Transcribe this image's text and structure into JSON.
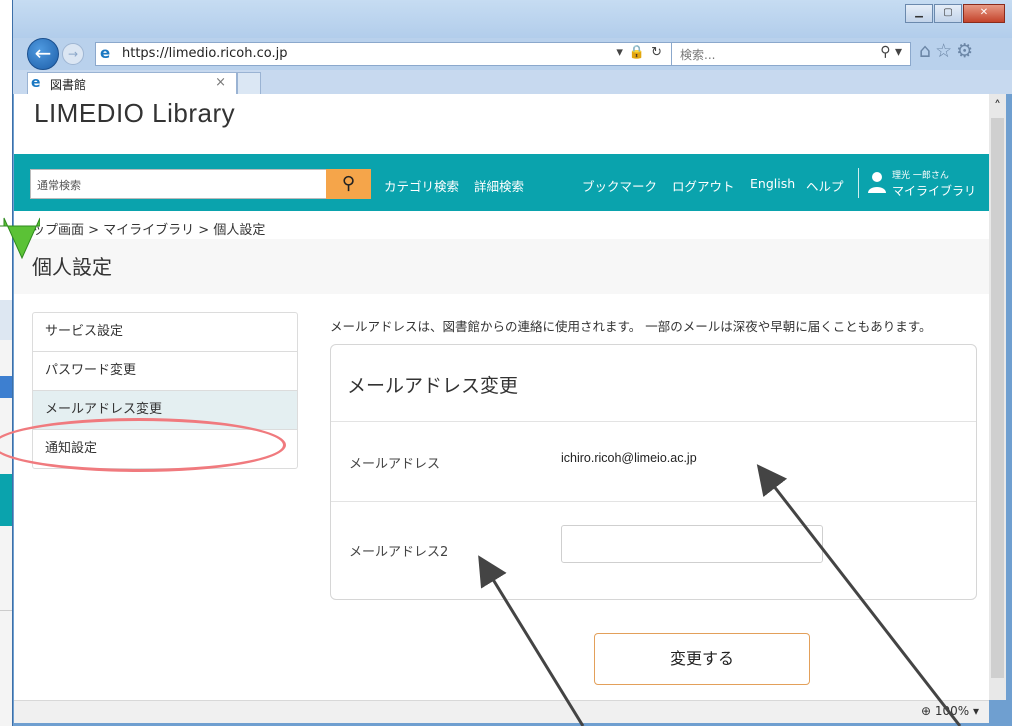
{
  "browser": {
    "url": "https://limedio.ricoh.co.jp",
    "search_placeholder": "検索...",
    "tab_title": "図書館",
    "tab_close": "×",
    "zoom": "100%",
    "window_controls": [
      "minimize-icon",
      "maximize-icon",
      "close-icon"
    ]
  },
  "site": {
    "brand": "LIMEDIO Library",
    "search_placeholder": "通常検索",
    "nav": {
      "category_search": "カテゴリ検索",
      "advanced_search": "詳細検索",
      "bookmark": "ブックマーク",
      "logout": "ログアウト",
      "english": "English",
      "help": "ヘルプ"
    },
    "user": {
      "name": "理光 一郎さん",
      "mylibrary": "マイライブラリ"
    },
    "colors": {
      "navbar": "#0aa3ad",
      "search_button": "#f5a54a",
      "button_border": "#e3a05a"
    }
  },
  "breadcrumb": "ップ画面 > マイライブラリ > 個人設定",
  "page_title": "個人設定",
  "sidebar": {
    "items": [
      {
        "label": "サービス設定"
      },
      {
        "label": "パスワード変更"
      },
      {
        "label": "メールアドレス変更",
        "active": true
      },
      {
        "label": "通知設定"
      }
    ]
  },
  "main": {
    "notice": "メールアドレスは、図書館からの連絡に使用されます。 一部のメールは深夜や早朝に届くこともあります。",
    "card_title": "メールアドレス変更",
    "email_label": "メールアドレス",
    "email_value": "ichiro.ricoh@limeio.ac.jp",
    "email2_label": "メールアドレス2",
    "email2_value": "",
    "submit": "変更する"
  }
}
